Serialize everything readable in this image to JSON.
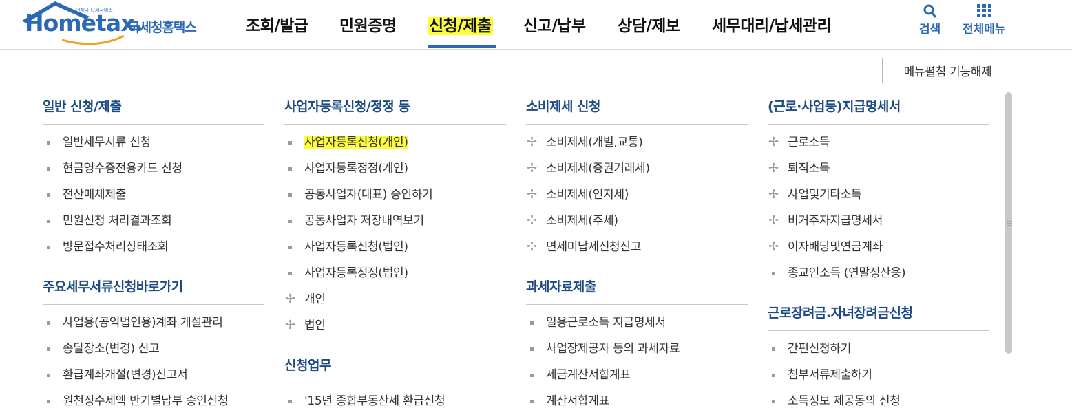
{
  "logo": {
    "en": "Hometax.",
    "small": "언제나 납세서비스",
    "kor": "국세청홈택스"
  },
  "gnb": [
    {
      "label": "조회/발급",
      "active": false
    },
    {
      "label": "민원증명",
      "active": false
    },
    {
      "label": "신청/제출",
      "active": true
    },
    {
      "label": "신고/납부",
      "active": false
    },
    {
      "label": "상담/제보",
      "active": false
    },
    {
      "label": "세무대리/납세관리",
      "active": false
    }
  ],
  "util": {
    "search": "검색",
    "all_menu": "전체메뉴"
  },
  "toggle_button": "메뉴펼침 기능해제",
  "colors": {
    "brand": "#2b69b7",
    "section_title": "#1c4a83",
    "highlight": "#fdfd3a"
  },
  "columns": [
    {
      "sections": [
        {
          "title": "일반 신청/제출",
          "items": [
            {
              "label": "일반세무서류 신청",
              "bullet": "square"
            },
            {
              "label": "현금영수증전용카드 신청",
              "bullet": "square"
            },
            {
              "label": "전산매체제출",
              "bullet": "square"
            },
            {
              "label": "민원신청 처리결과조회",
              "bullet": "square"
            },
            {
              "label": "방문접수처리상태조회",
              "bullet": "square"
            }
          ]
        },
        {
          "title": "주요세무서류신청바로가기",
          "items": [
            {
              "label": "사업용(공익법인용)계좌 개설관리",
              "bullet": "square"
            },
            {
              "label": "송달장소(변경) 신고",
              "bullet": "square"
            },
            {
              "label": "환급계좌개설(변경)신고서",
              "bullet": "square"
            },
            {
              "label": "원천징수세액 반기별납부 승인신청",
              "bullet": "square"
            }
          ]
        }
      ]
    },
    {
      "sections": [
        {
          "title": "사업자등록신청/정정 등",
          "items": [
            {
              "label": "사업자등록신청(개인)",
              "bullet": "square",
              "highlight": true
            },
            {
              "label": "사업자등록정정(개인)",
              "bullet": "square"
            },
            {
              "label": "공동사업자(대표) 승인하기",
              "bullet": "square"
            },
            {
              "label": "공동사업자 저장내역보기",
              "bullet": "square"
            },
            {
              "label": "사업자등록신청(법인)",
              "bullet": "square"
            },
            {
              "label": "사업자등록정정(법인)",
              "bullet": "square"
            },
            {
              "label": "개인",
              "bullet": "plus"
            },
            {
              "label": "법인",
              "bullet": "plus"
            }
          ]
        },
        {
          "title": "신청업무",
          "items": [
            {
              "label": "'15년 종합부동산세 환급신청",
              "bullet": "square"
            }
          ]
        }
      ]
    },
    {
      "sections": [
        {
          "title": "소비제세 신청",
          "items": [
            {
              "label": "소비제세(개별,교통)",
              "bullet": "plus"
            },
            {
              "label": "소비제세(증권거래세)",
              "bullet": "plus"
            },
            {
              "label": "소비제세(인지세)",
              "bullet": "plus"
            },
            {
              "label": "소비제세(주세)",
              "bullet": "plus"
            },
            {
              "label": "면세미납세신청신고",
              "bullet": "plus"
            }
          ]
        },
        {
          "title": "과세자료제출",
          "items": [
            {
              "label": "일용근로소득 지급명세서",
              "bullet": "square"
            },
            {
              "label": "사업장제공자 등의 과세자료",
              "bullet": "square"
            },
            {
              "label": "세금계산서합계표",
              "bullet": "square"
            },
            {
              "label": "계산서합계표",
              "bullet": "square"
            }
          ]
        }
      ]
    },
    {
      "sections": [
        {
          "title": "(근로·사업등)지급명세서",
          "items": [
            {
              "label": "근로소득",
              "bullet": "plus"
            },
            {
              "label": "퇴직소득",
              "bullet": "plus"
            },
            {
              "label": "사업및기타소득",
              "bullet": "plus"
            },
            {
              "label": "비거주자지급명세서",
              "bullet": "plus"
            },
            {
              "label": "이자배당및연금계좌",
              "bullet": "plus"
            },
            {
              "label": "종교인소득 (연말정산용)",
              "bullet": "square"
            }
          ]
        },
        {
          "title": "근로장려금.자녀장려금신청",
          "items": [
            {
              "label": "간편신청하기",
              "bullet": "square"
            },
            {
              "label": "첨부서류제출하기",
              "bullet": "square"
            },
            {
              "label": "소득정보 제공동의 신청",
              "bullet": "square"
            }
          ]
        }
      ]
    }
  ]
}
